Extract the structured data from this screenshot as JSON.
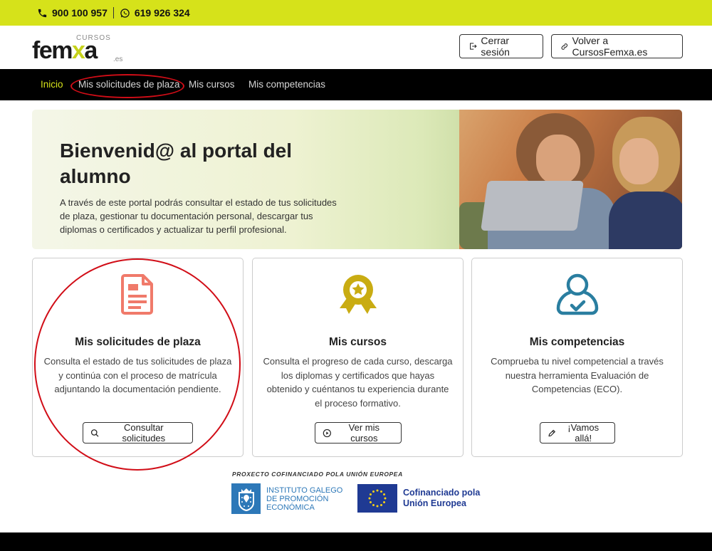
{
  "topbar": {
    "phone1": "900 100 957",
    "phone2": "619 926 324"
  },
  "header": {
    "logo_cursos": "CURSOS",
    "logo_fem": "fem",
    "logo_x": "x",
    "logo_a": "a",
    "logo_es": ".es",
    "logout_label": "Cerrar sesión",
    "back_label": "Volver a CursosFemxa.es"
  },
  "nav": {
    "items": [
      {
        "label": "Inicio"
      },
      {
        "label": "Mis solicitudes de plaza"
      },
      {
        "label": "Mis cursos"
      },
      {
        "label": "Mis competencias"
      }
    ]
  },
  "hero": {
    "title": "Bienvenid@ al portal del alumno",
    "text": "A través de este portal podrás consultar el estado de tus solicitudes de plaza, gestionar tu documentación personal, descargar tus diplomas o certificados y actualizar tu perfil profesional."
  },
  "cards": [
    {
      "icon": "document-icon",
      "title": "Mis solicitudes de plaza",
      "text": "Consulta el estado de tus solicitudes de plaza y continúa con el proceso de matrícula adjuntando la documentación pendiente.",
      "button": "Consultar solicitudes",
      "color": "#f07a6a"
    },
    {
      "icon": "award-icon",
      "title": "Mis cursos",
      "text": "Consulta el progreso de cada curso, descarga los diplomas y certificados que hayas obtenido y cuéntanos tu experiencia durante el proceso formativo.",
      "button": "Ver mis cursos",
      "color": "#c9ac12"
    },
    {
      "icon": "user-check-icon",
      "title": "Mis competencias",
      "text": "Comprueba tu nivel competencial a través nuestra herramienta Evaluación de Competencias (ECO).",
      "button": "¡Vamos allá!",
      "color": "#2a7ea0"
    }
  ],
  "footer": {
    "cofinanced": "PROXECTO COFINANCIADO POLA UNIÓN EUROPEA",
    "igape_line1": "INSTITUTO GALEGO",
    "igape_line2": "DE PROMOCIÓN",
    "igape_line3": "ECONÓMICA",
    "eu_line1": "Cofinanciado pola",
    "eu_line2": "Unión Europea"
  },
  "colors": {
    "accent": "#d6e21a",
    "highlight": "#d10d17"
  }
}
